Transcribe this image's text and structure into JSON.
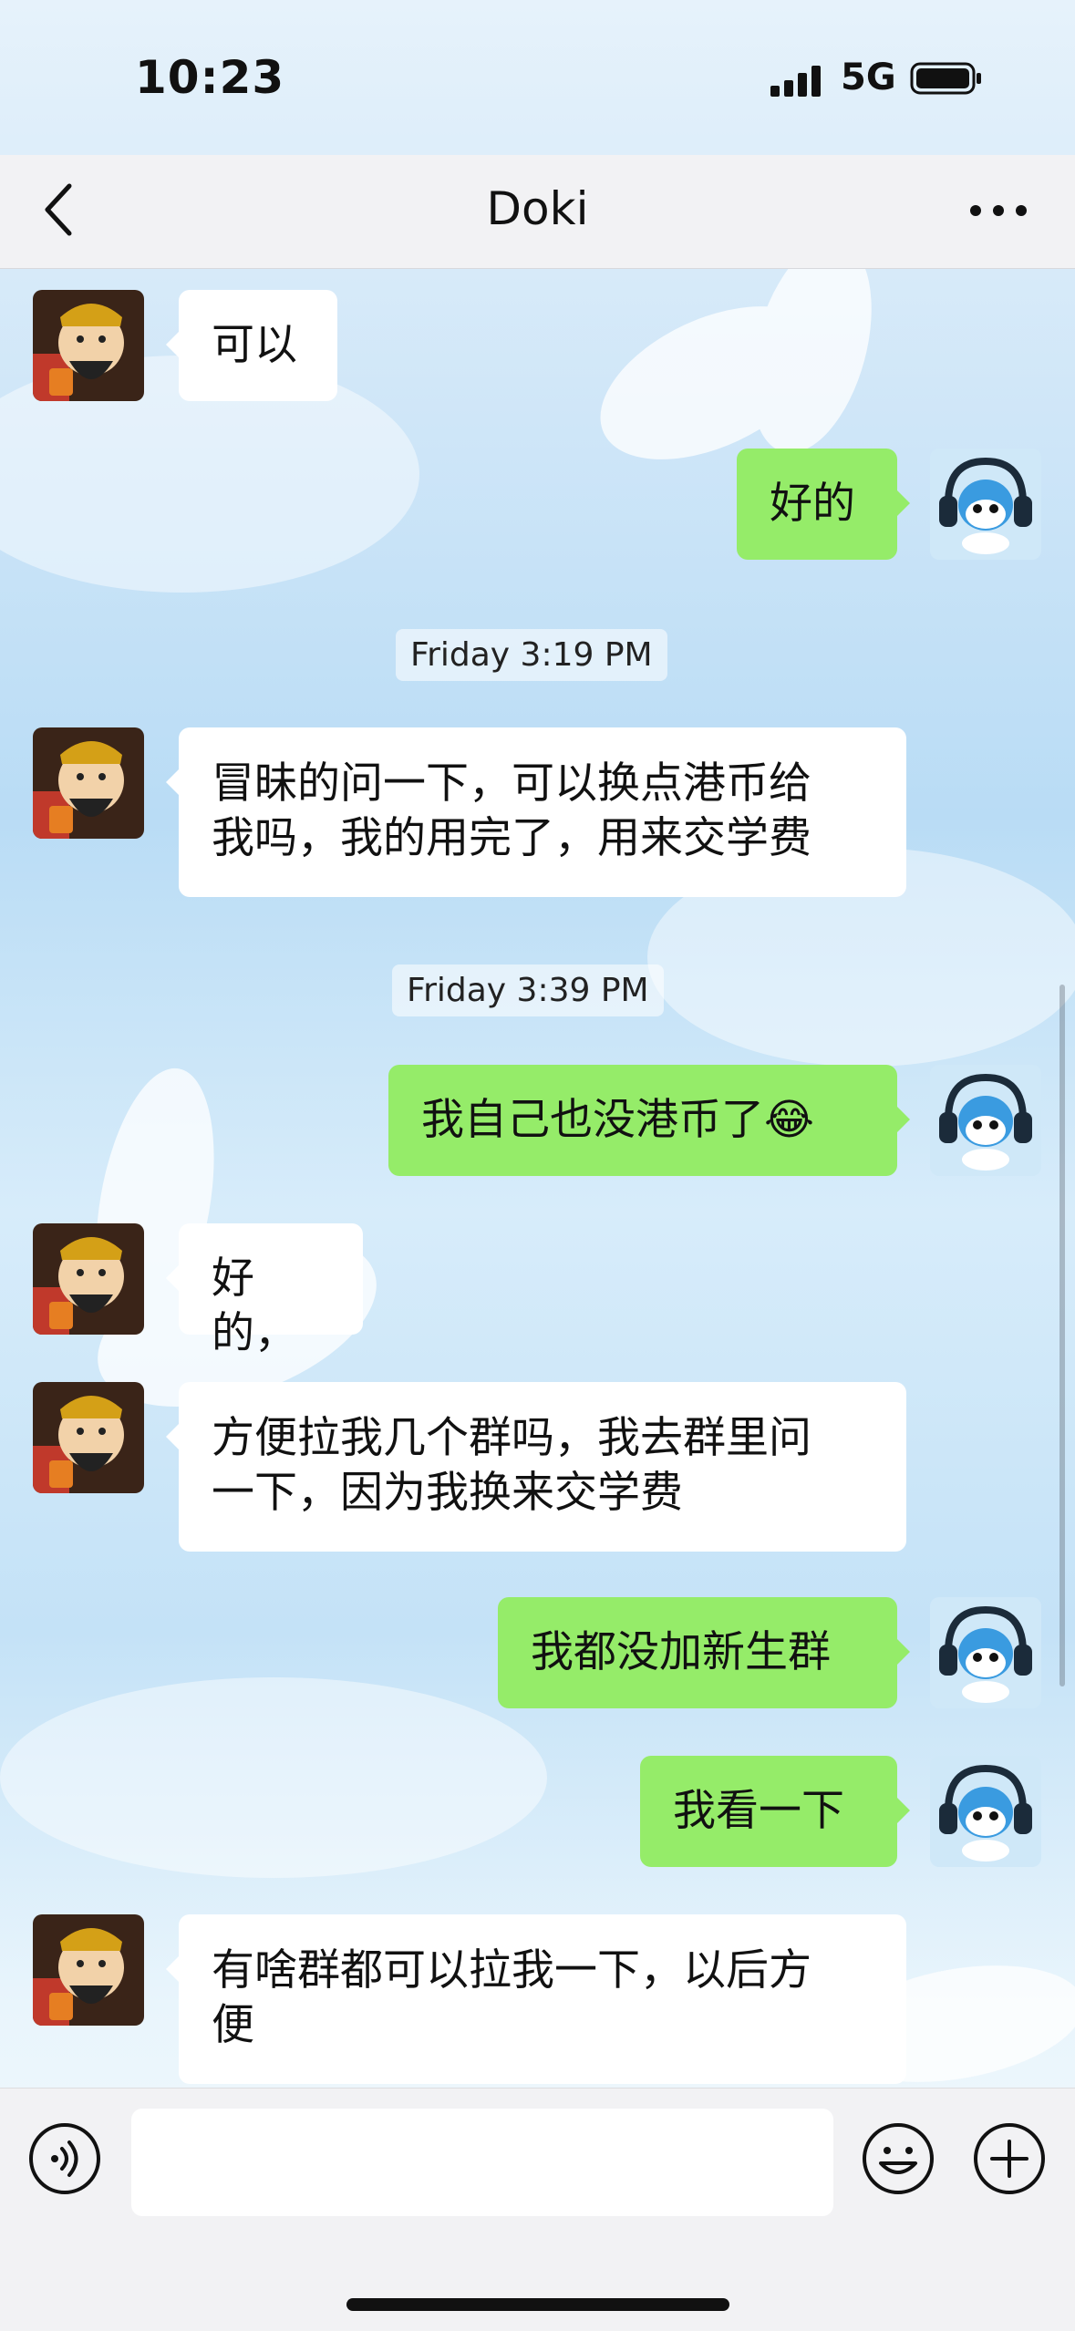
{
  "status_bar": {
    "time": "10:23",
    "network": "5G"
  },
  "header": {
    "title": "Doki"
  },
  "messages": [
    {
      "side": "in",
      "text": "可以"
    },
    {
      "side": "out",
      "text": "好的"
    },
    {
      "type": "timestamp",
      "text": "Friday 3:19 PM"
    },
    {
      "side": "in",
      "lines": [
        "冒昧的问一下，可以换点港币给",
        "我吗，我的用完了，用来交学费"
      ]
    },
    {
      "type": "timestamp",
      "text": "Friday 3:39 PM"
    },
    {
      "side": "out",
      "text": "我自己也没港币了😂"
    },
    {
      "side": "in",
      "text": "好的，"
    },
    {
      "side": "in",
      "lines": [
        "方便拉我几个群吗，我去群里问",
        "一下，因为我换来交学费"
      ]
    },
    {
      "side": "out",
      "text": "我都没加新生群"
    },
    {
      "side": "out",
      "text": "我看一下"
    },
    {
      "side": "in",
      "lines": [
        "有啥群都可以拉我一下，以后方",
        "便"
      ]
    }
  ],
  "icons": {
    "back": "chevron-left-icon",
    "more": "more-dots-icon",
    "voice": "voice-input-icon",
    "emoji": "emoji-icon",
    "plus": "plus-icon",
    "signal": "signal-icon",
    "battery": "battery-icon"
  },
  "colors": {
    "outgoing_bubble": "#95ec69",
    "incoming_bubble": "#ffffff",
    "bar": "#f2f2f4"
  }
}
